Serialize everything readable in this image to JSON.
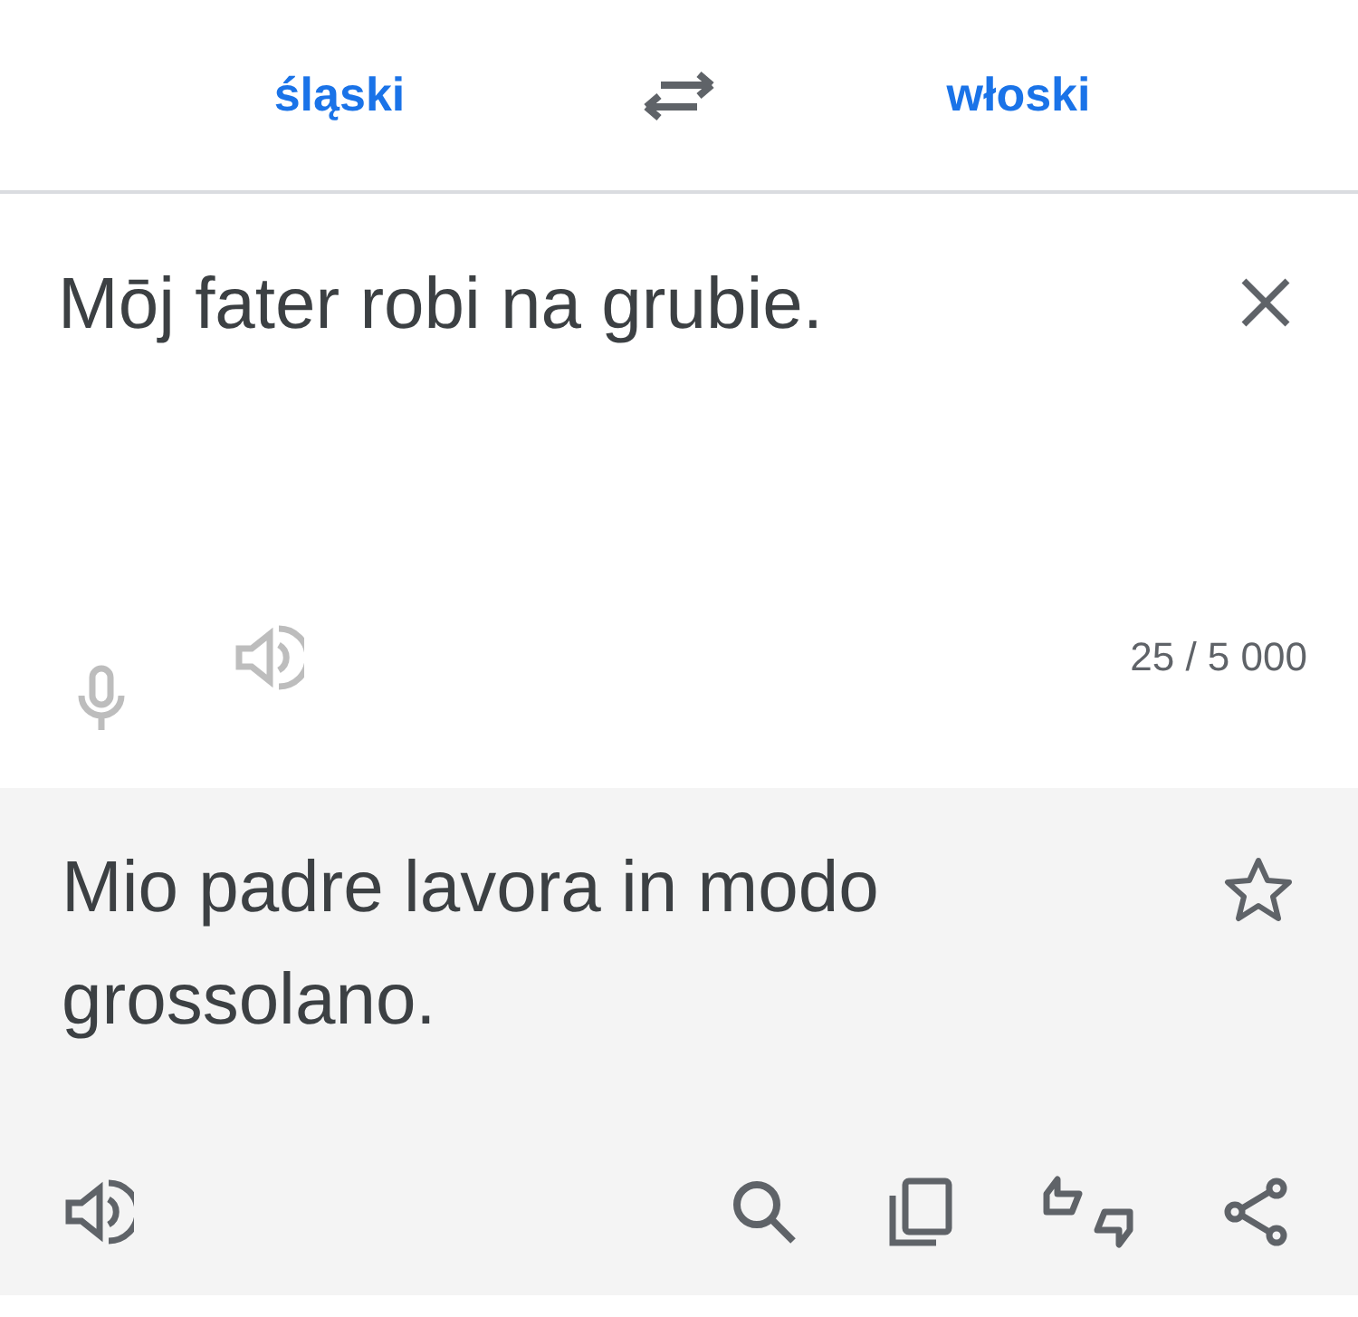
{
  "languages": {
    "source": "śląski",
    "target": "włoski"
  },
  "input": {
    "value": "Mōj fater robi na grubie.",
    "counter": "25 / 5 000",
    "tools": [
      {
        "kind": "mic",
        "disabled": true
      },
      {
        "kind": "speaker",
        "disabled": true
      }
    ]
  },
  "output": {
    "text": "Mio padre lavora in modo grossolano.",
    "starred": false,
    "tools": [
      {
        "kind": "speaker",
        "disabled": false
      },
      {
        "kind": "search",
        "disabled": false
      },
      {
        "kind": "copy",
        "disabled": false
      },
      {
        "kind": "feedback",
        "disabled": false
      },
      {
        "kind": "share",
        "disabled": false
      }
    ]
  }
}
